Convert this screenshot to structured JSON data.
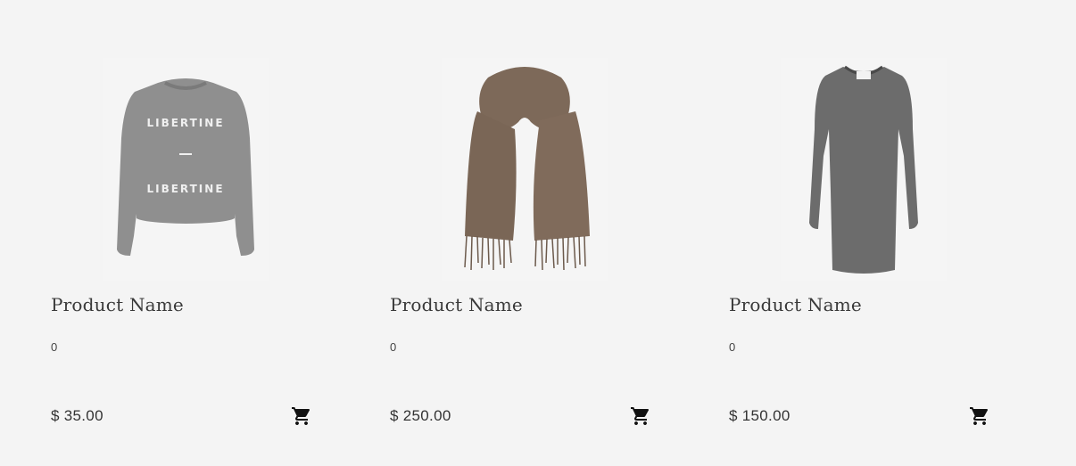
{
  "products": [
    {
      "name": "Product Name",
      "description": "0",
      "price": "$ 35.00",
      "image_icon": "sweatshirt-image",
      "print_text": "LIBERTINE",
      "cart_icon": "cart-icon"
    },
    {
      "name": "Product Name",
      "description": "0",
      "price": "$ 250.00",
      "image_icon": "scarf-image",
      "cart_icon": "cart-icon"
    },
    {
      "name": "Product Name",
      "description": "0",
      "price": "$ 150.00",
      "image_icon": "dress-image",
      "cart_icon": "cart-icon"
    }
  ],
  "colors": {
    "background": "#f4f4f4",
    "sweatshirt": "#8f8f8f",
    "scarf": "#7d6959",
    "dress": "#6c6c6c"
  }
}
